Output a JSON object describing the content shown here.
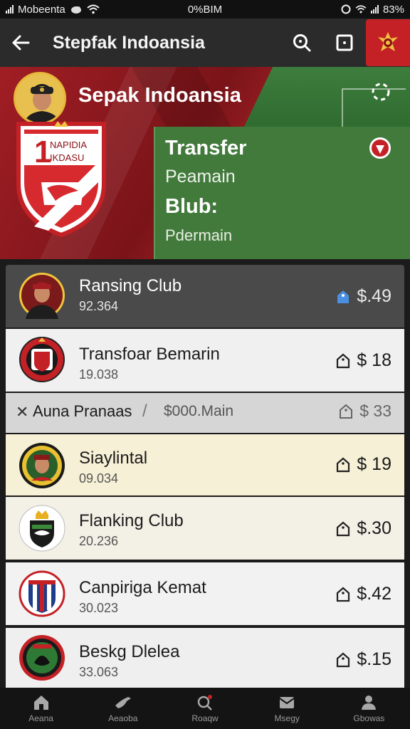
{
  "status_bar": {
    "carrier": "Mobeenta",
    "time": "0%BIM",
    "battery": "83%"
  },
  "header": {
    "title": "Stepfak Indoansia"
  },
  "hero": {
    "title": "Sepak Indoansia",
    "crest_text_1": "NAPIDIA",
    "crest_text_2": "IKDASU",
    "crest_number": "1",
    "panel_heading": "Transfer",
    "panel_line_1": "Peamain",
    "panel_heading_2": "Blub:",
    "panel_line_2": "Pdermain"
  },
  "list": [
    {
      "name": "Ransing Club",
      "sub": "92.364",
      "price": "$.49"
    },
    {
      "name": "Transfoar Bemarin",
      "sub": "19.038",
      "price": "$ 18"
    },
    {
      "name": "Auna Pranaas",
      "meta": "$000.Main",
      "price": "$ 33"
    },
    {
      "name": "Siaylintal",
      "sub": "09.034",
      "price": "$ 19"
    },
    {
      "name": "Flanking Club",
      "sub": "20.236",
      "price": "$.30"
    },
    {
      "name": "Canpiriga Kemat",
      "sub": "30.023",
      "price": "$.42"
    },
    {
      "name": "Beskg Dlelea",
      "sub": "33.063",
      "price": "$.15"
    }
  ],
  "bottom_nav": [
    {
      "label": "Aeana",
      "icon": "home-icon"
    },
    {
      "label": "Aeaoba",
      "icon": "bird-icon"
    },
    {
      "label": "Roaqw",
      "icon": "search-icon"
    },
    {
      "label": "Msegy",
      "icon": "mail-icon"
    },
    {
      "label": "Gbowas",
      "icon": "person-icon"
    }
  ],
  "colors": {
    "brand_red": "#c42126",
    "field_green": "#427a3c",
    "accent_blue": "#4a8fe0"
  }
}
